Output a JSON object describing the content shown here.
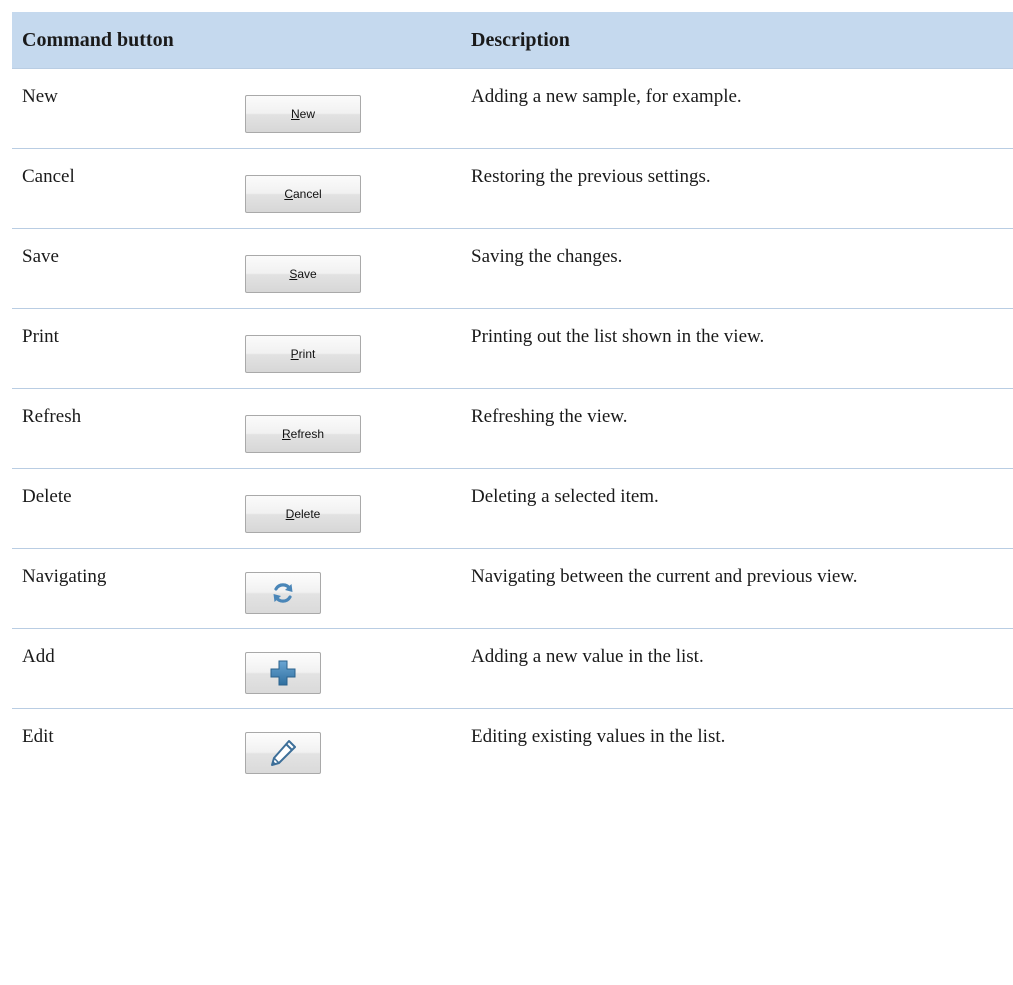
{
  "header": {
    "col1": "Command button",
    "col2": "Description"
  },
  "rows": [
    {
      "name": "New",
      "button_accel": "N",
      "button_rest": "ew",
      "description": "Adding a new sample, for example."
    },
    {
      "name": "Cancel",
      "button_accel": "C",
      "button_rest": "ancel",
      "description": "Restoring the previous settings."
    },
    {
      "name": "Save",
      "button_accel": "S",
      "button_rest": "ave",
      "description": "Saving the changes."
    },
    {
      "name": "Print",
      "button_accel": "P",
      "button_rest": "rint",
      "description": "Printing out the list shown in the view."
    },
    {
      "name": "Refresh",
      "button_accel": "R",
      "button_rest": "efresh",
      "description": "Refreshing the view."
    },
    {
      "name": "Delete",
      "button_accel": "D",
      "button_rest": "elete",
      "description": "Deleting a selected item."
    },
    {
      "name": "Navigating",
      "icon": "refresh-arrows-icon",
      "description": "Navigating between the current and previous view."
    },
    {
      "name": "Add",
      "icon": "plus-icon",
      "description": "Adding a new value in the list."
    },
    {
      "name": "Edit",
      "icon": "pencil-icon",
      "description": "Editing existing values in the list."
    }
  ],
  "colors": {
    "header_bg": "#c5d9ee",
    "row_divider": "#b9cde3",
    "icon_blue": "#4a86b8"
  }
}
